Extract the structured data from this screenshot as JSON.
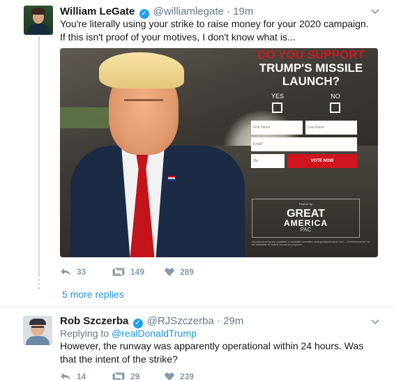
{
  "tweet1": {
    "name": "William LeGate",
    "handle": "@williamlegate",
    "separator": "·",
    "time": "19m",
    "text": "You're literally using your strike to raise money for your 2020 campaign. If this isn't proof of your motives, I don't know what is...",
    "stats": {
      "replies": "33",
      "retweets": "149",
      "likes": "289"
    }
  },
  "ad": {
    "line1": "DO YOU SUPPORT",
    "line2": "TRUMP'S MISSILE",
    "line3": "LAUNCH?",
    "yes": "YES",
    "no": "NO",
    "first_name": "First Name",
    "last_name": "Last Name",
    "email": "Email*",
    "zip": "Zip",
    "vote": "VOTE NOW",
    "paid_for": "Paid for by",
    "great": "GREAT",
    "america": "AMERICA",
    "pac": "PAC",
    "fine_print": "Not authorized by any candidate or candidate committee. www.greatamericapac.com — Contributions are not tax deductible for federal income tax purposes."
  },
  "thread": {
    "more_replies": "5 more replies"
  },
  "tweet2": {
    "name": "Rob Szczerba",
    "handle": "@RJSzczerba",
    "separator": "·",
    "time": "29m",
    "replying_prefix": "Replying to",
    "replying_to": "@realDonaldTrump",
    "text": "However, the runway was apparently operational within 24 hours. Was that the intent of the strike?",
    "stats": {
      "replies": "14",
      "retweets": "29",
      "likes": "239"
    }
  },
  "colors": {
    "link": "#1b95e0",
    "verified": "#1da1f2",
    "muted": "#657786",
    "ad_red": "#c81d25"
  },
  "icons": [
    "reply-icon",
    "retweet-icon",
    "like-icon",
    "chevron-down-icon",
    "verified-badge-icon"
  ]
}
